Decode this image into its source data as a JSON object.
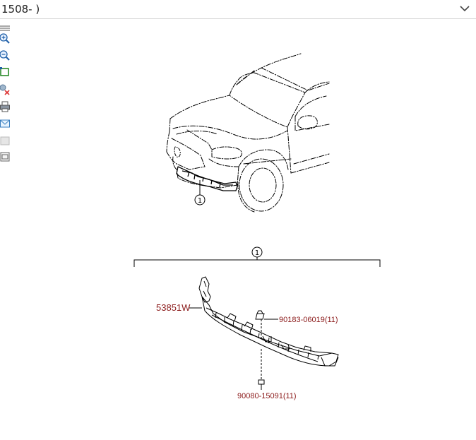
{
  "header": {
    "title": "1508- )",
    "dropdown_icon": "chevron-down-icon"
  },
  "toolbar": {
    "tools": [
      "menu-lines-icon",
      "zoom-in-icon",
      "zoom-out-icon",
      "fit-window-icon",
      "remove-highlight-icon",
      "print-icon",
      "email-icon",
      "blank-icon",
      "image-icon"
    ]
  },
  "diagram": {
    "callout_top": "1",
    "callout_group": "1",
    "parts": [
      {
        "number": "53851W"
      },
      {
        "number": "90183-06019(11)"
      },
      {
        "number": "90080-15091(11)"
      }
    ],
    "label_color": "#8b1a1a"
  }
}
